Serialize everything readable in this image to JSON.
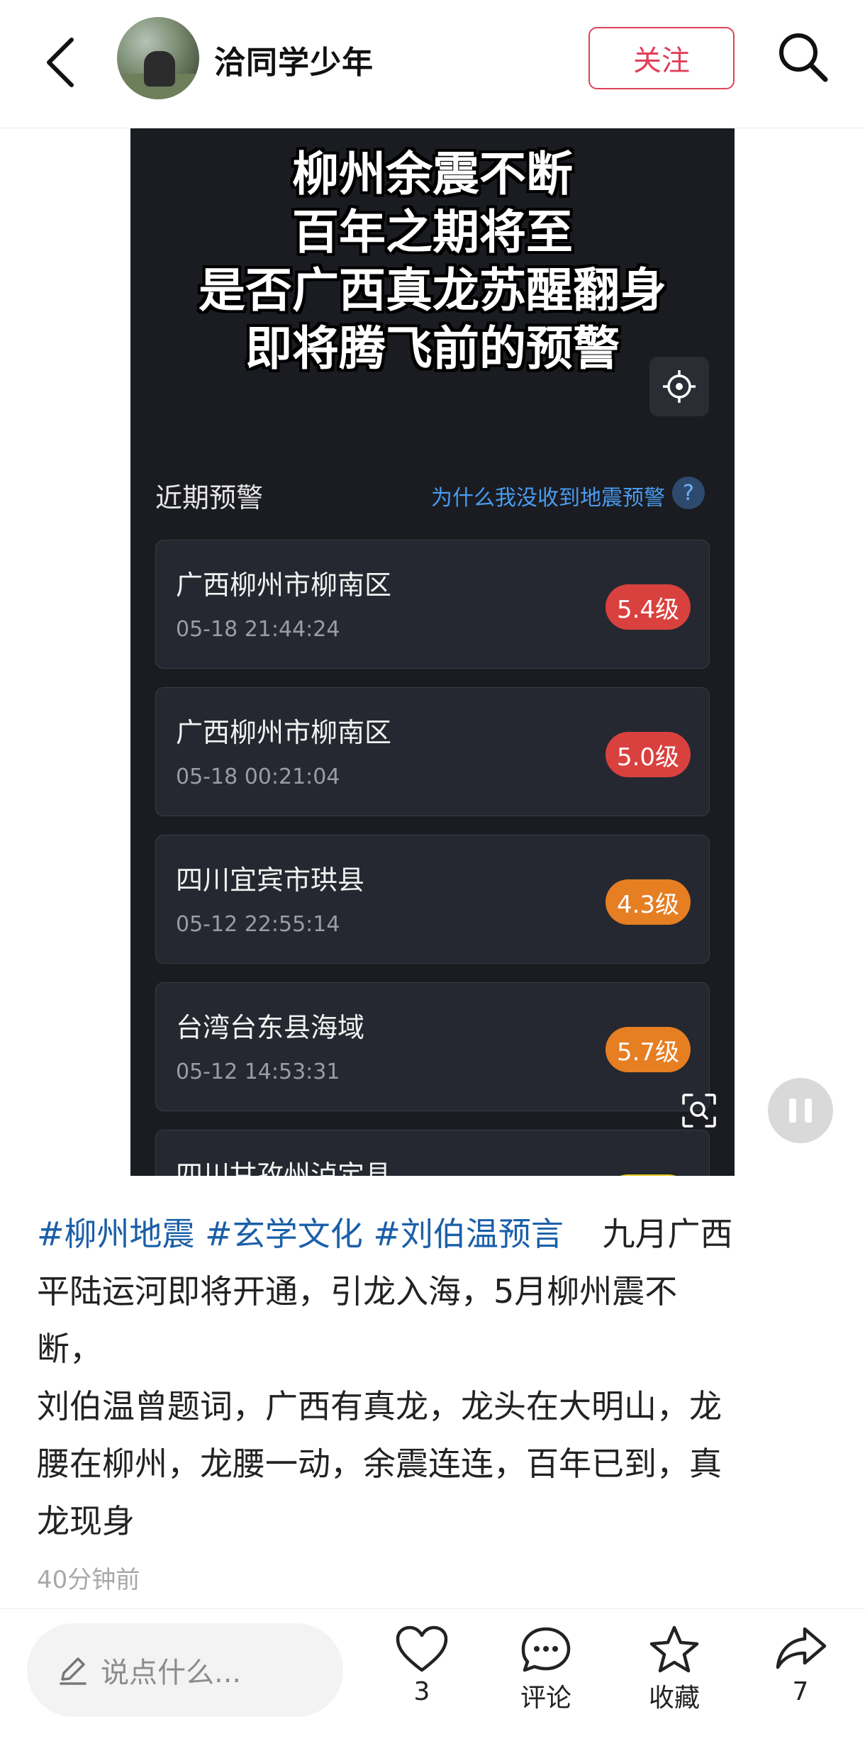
{
  "header": {
    "username": "洽同学少年",
    "follow_label": "关注"
  },
  "media": {
    "overlay_title_lines": [
      "柳州余震不断",
      "百年之期将至",
      "是否广西真龙苏醒翻身",
      "即将腾飞前的预警"
    ],
    "section_title": "近期预警",
    "why_link": "为什么我没收到地震预警",
    "help_glyph": "?",
    "quakes": [
      {
        "location": "广西柳州市柳南区",
        "time": "05-18 21:44:24",
        "magnitude": "5.4级",
        "color": "#d9413e"
      },
      {
        "location": "广西柳州市柳南区",
        "time": "05-18 00:21:04",
        "magnitude": "5.0级",
        "color": "#d9413e"
      },
      {
        "location": "四川宜宾市珙县",
        "time": "05-12 22:55:14",
        "magnitude": "4.3级",
        "color": "#e67e22"
      },
      {
        "location": "台湾台东县海域",
        "time": "05-12 14:53:31",
        "magnitude": "5.7级",
        "color": "#e67e22"
      },
      {
        "location": "四川甘孜州泸定县",
        "time": "",
        "magnitude": "",
        "color": "#e6c619"
      }
    ]
  },
  "post": {
    "tags": [
      "#柳州地震",
      "#玄学文化",
      "#刘伯温预言"
    ],
    "line1_rest": "九月广西",
    "line2": "平陆运河即将开通，引龙入海，5月柳州震不",
    "line3": "断，",
    "line4": "刘伯温曾题词，广西有真龙，龙头在大明山，龙",
    "line5": "腰在柳州，龙腰一动，余震连连，百年已到，真",
    "line6": "龙现身",
    "time": "40分钟前"
  },
  "bottom": {
    "comment_placeholder": "说点什么...",
    "like_count": "3",
    "comment_label": "评论",
    "favorite_label": "收藏",
    "share_count": "7"
  },
  "colors": {
    "accent": "#e0405a",
    "tag": "#1a5fa8",
    "link": "#4a9bf0"
  }
}
